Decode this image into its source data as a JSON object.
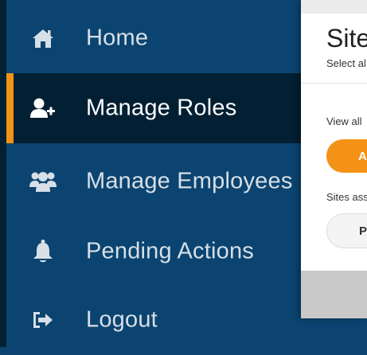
{
  "sidebar": {
    "items": [
      {
        "label": "Home",
        "icon": "home-icon",
        "active": false
      },
      {
        "label": "Manage Roles",
        "icon": "add-user-icon",
        "active": true
      },
      {
        "label": "Manage Employees",
        "icon": "users-icon",
        "active": false
      },
      {
        "label": "Pending Actions",
        "icon": "bell-icon",
        "active": false
      },
      {
        "label": "Logout",
        "icon": "logout-icon",
        "active": false
      }
    ]
  },
  "modal": {
    "title": "Site",
    "subtitle": "Select al",
    "view_all_text": "View all",
    "primary_button_label": "A",
    "assigned_text": "Sites ass",
    "secondary_button_label": "P"
  },
  "colors": {
    "sidebar_bg": "#0b4470",
    "active_bg": "#031f33",
    "accent": "#f39217",
    "icon": "#d7dfe7"
  }
}
